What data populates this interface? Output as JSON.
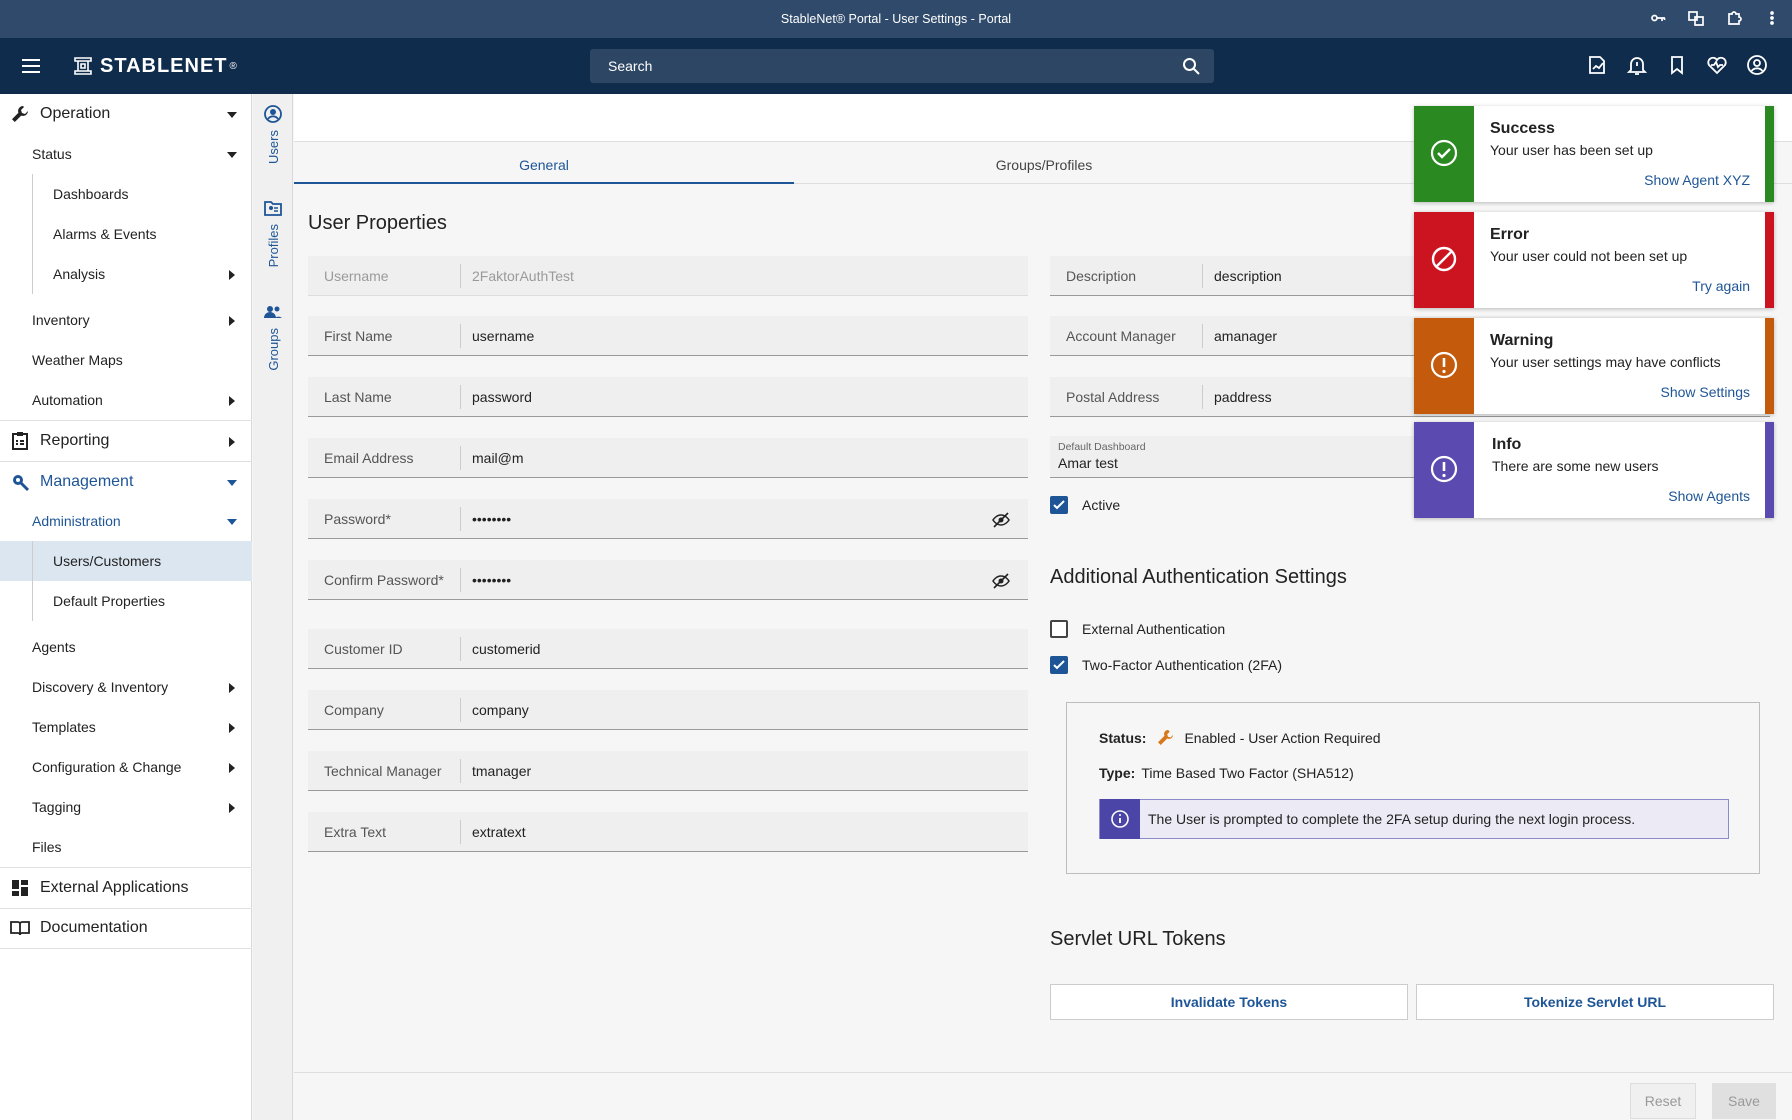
{
  "window": {
    "title": "StableNet® Portal - User Settings - Portal"
  },
  "topnav": {
    "logo_text": "STABLENET",
    "logo_mark": "®",
    "search_placeholder": "Search"
  },
  "leftnav": {
    "operation": "Operation",
    "status": "Status",
    "dashboards": "Dashboards",
    "alarms": "Alarms & Events",
    "analysis": "Analysis",
    "inventory": "Inventory",
    "weather_maps": "Weather Maps",
    "automation": "Automation",
    "reporting": "Reporting",
    "management": "Management",
    "administration": "Administration",
    "users_customers": "Users/Customers",
    "default_properties": "Default Properties",
    "agents": "Agents",
    "discovery": "Discovery & Inventory",
    "templates": "Templates",
    "config_change": "Configuration & Change",
    "tagging": "Tagging",
    "files": "Files",
    "external_apps": "External Applications",
    "documentation": "Documentation"
  },
  "vtabs": {
    "users": "Users",
    "profiles": "Profiles",
    "groups": "Groups"
  },
  "tabs": {
    "general": "General",
    "groups_profiles": "Groups/Profiles"
  },
  "user_properties": {
    "title": "User Properties",
    "username": {
      "label": "Username",
      "value": "2FaktorAuthTest"
    },
    "first_name": {
      "label": "First Name",
      "value": "username"
    },
    "last_name": {
      "label": "Last Name",
      "value": "password"
    },
    "email": {
      "label": "Email Address",
      "value": "mail@m"
    },
    "password": {
      "label": "Password*",
      "value": "••••••••"
    },
    "confirm_password": {
      "label": "Confirm Password*",
      "value": "••••••••"
    },
    "customer_id": {
      "label": "Customer ID",
      "value": "customerid"
    },
    "company": {
      "label": "Company",
      "value": "company"
    },
    "technical_manager": {
      "label": "Technical Manager",
      "value": "tmanager"
    },
    "extra_text": {
      "label": "Extra Text",
      "value": "extratext"
    }
  },
  "right_props": {
    "description": {
      "label": "Description",
      "value": "description"
    },
    "account_manager": {
      "label": "Account Manager",
      "value": "amanager"
    },
    "postal_address": {
      "label": "Postal Address",
      "value": "paddress"
    },
    "default_dashboard": {
      "label": "Default Dashboard",
      "value": "Amar test"
    },
    "active": {
      "label": "Active",
      "checked": true
    }
  },
  "auth": {
    "title": "Additional Authentication Settings",
    "external": {
      "label": "External Authentication",
      "checked": false
    },
    "twofa": {
      "label": "Two-Factor Authentication (2FA)",
      "checked": true
    },
    "status_label": "Status:",
    "status_value": "Enabled - User Action Required",
    "type_label": "Type:",
    "type_value": "Time Based Two Factor (SHA512)",
    "info_text": "The User is prompted to complete the 2FA setup during the next login process."
  },
  "servlet": {
    "title": "Servlet URL Tokens",
    "invalidate": "Invalidate Tokens",
    "tokenize": "Tokenize Servlet URL"
  },
  "footer": {
    "reset": "Reset",
    "save": "Save"
  },
  "toasts": [
    {
      "title": "Success",
      "message": "Your user has been set up",
      "link": "Show Agent XYZ",
      "color": "#2a8a21",
      "icon": "check-circle-icon"
    },
    {
      "title": "Error",
      "message": "Your user could not been set up",
      "link": "Try again",
      "color": "#cc1420",
      "icon": "block-icon"
    },
    {
      "title": "Warning",
      "message": "Your user settings may have conflicts",
      "link": "Show Settings",
      "color": "#c35a0c",
      "icon": "alert-circle-icon"
    },
    {
      "title": "Info",
      "message": "There are some new users",
      "link": "Show Agents",
      "color": "#5b4bb0",
      "icon": "info-alert-icon"
    }
  ],
  "colors": {
    "accent": "#1e5596",
    "topnav": "#0f2c4c",
    "titlebar": "#2f4a6a"
  }
}
